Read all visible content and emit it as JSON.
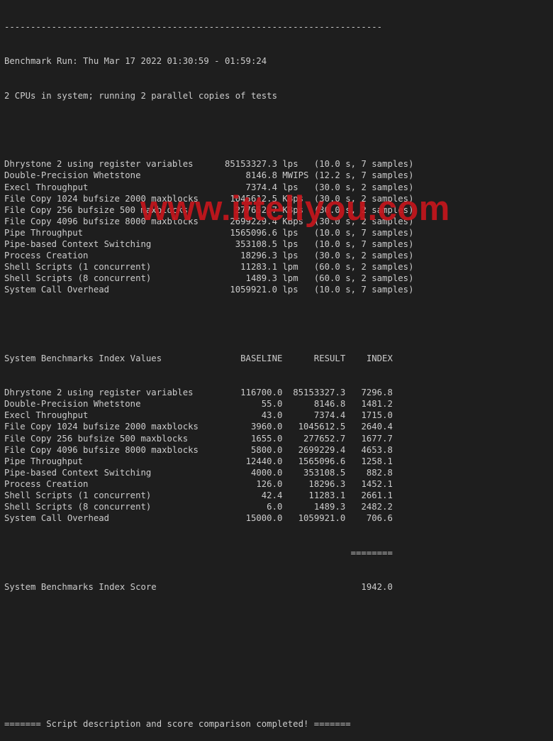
{
  "terminal": {
    "separator": "------------------------------------------------------------------------",
    "benchmark_run": "Benchmark Run: Thu Mar 17 2022 01:30:59 - 01:59:24",
    "cpu_info": "2 CPUs in system; running 2 parallel copies of tests",
    "results": [
      {
        "test": "Dhrystone 2 using register variables",
        "value": "85153327.3",
        "unit": "lps",
        "time": "10.0 s",
        "samples": "7 samples"
      },
      {
        "test": "Double-Precision Whetstone",
        "value": "8146.8",
        "unit": "MWIPS",
        "time": "12.2 s",
        "samples": "7 samples"
      },
      {
        "test": "Execl Throughput",
        "value": "7374.4",
        "unit": "lps",
        "time": "30.0 s",
        "samples": "2 samples"
      },
      {
        "test": "File Copy 1024 bufsize 2000 maxblocks",
        "value": "1045612.5",
        "unit": "KBps",
        "time": "30.0 s",
        "samples": "2 samples"
      },
      {
        "test": "File Copy 256 bufsize 500 maxblocks",
        "value": "277652.7",
        "unit": "KBps",
        "time": "30.0 s",
        "samples": "2 samples"
      },
      {
        "test": "File Copy 4096 bufsize 8000 maxblocks",
        "value": "2699229.4",
        "unit": "KBps",
        "time": "30.0 s",
        "samples": "2 samples"
      },
      {
        "test": "Pipe Throughput",
        "value": "1565096.6",
        "unit": "lps",
        "time": "10.0 s",
        "samples": "7 samples"
      },
      {
        "test": "Pipe-based Context Switching",
        "value": "353108.5",
        "unit": "lps",
        "time": "10.0 s",
        "samples": "7 samples"
      },
      {
        "test": "Process Creation",
        "value": "18296.3",
        "unit": "lps",
        "time": "30.0 s",
        "samples": "2 samples"
      },
      {
        "test": "Shell Scripts (1 concurrent)",
        "value": "11283.1",
        "unit": "lpm",
        "time": "60.0 s",
        "samples": "2 samples"
      },
      {
        "test": "Shell Scripts (8 concurrent)",
        "value": "1489.3",
        "unit": "lpm",
        "time": "60.0 s",
        "samples": "2 samples"
      },
      {
        "test": "System Call Overhead",
        "value": "1059921.0",
        "unit": "lps",
        "time": "10.0 s",
        "samples": "7 samples"
      }
    ],
    "index_header": {
      "title": "System Benchmarks Index Values",
      "baseline": "BASELINE",
      "result": "RESULT",
      "index": "INDEX"
    },
    "index_rows": [
      {
        "test": "Dhrystone 2 using register variables",
        "baseline": "116700.0",
        "result": "85153327.3",
        "index": "7296.8"
      },
      {
        "test": "Double-Precision Whetstone",
        "baseline": "55.0",
        "result": "8146.8",
        "index": "1481.2"
      },
      {
        "test": "Execl Throughput",
        "baseline": "43.0",
        "result": "7374.4",
        "index": "1715.0"
      },
      {
        "test": "File Copy 1024 bufsize 2000 maxblocks",
        "baseline": "3960.0",
        "result": "1045612.5",
        "index": "2640.4"
      },
      {
        "test": "File Copy 256 bufsize 500 maxblocks",
        "baseline": "1655.0",
        "result": "277652.7",
        "index": "1677.7"
      },
      {
        "test": "File Copy 4096 bufsize 8000 maxblocks",
        "baseline": "5800.0",
        "result": "2699229.4",
        "index": "4653.8"
      },
      {
        "test": "Pipe Throughput",
        "baseline": "12440.0",
        "result": "1565096.6",
        "index": "1258.1"
      },
      {
        "test": "Pipe-based Context Switching",
        "baseline": "4000.0",
        "result": "353108.5",
        "index": "882.8"
      },
      {
        "test": "Process Creation",
        "baseline": "126.0",
        "result": "18296.3",
        "index": "1452.1"
      },
      {
        "test": "Shell Scripts (1 concurrent)",
        "baseline": "42.4",
        "result": "11283.1",
        "index": "2661.1"
      },
      {
        "test": "Shell Scripts (8 concurrent)",
        "baseline": "6.0",
        "result": "1489.3",
        "index": "2482.2"
      },
      {
        "test": "System Call Overhead",
        "baseline": "15000.0",
        "result": "1059921.0",
        "index": "706.6"
      }
    ],
    "score_separator": "========",
    "score_label": "System Benchmarks Index Score",
    "score_value": "1942.0",
    "completion_message": "======= Script description and score comparison completed! ======="
  },
  "watermark": {
    "text": "www.ittellyou.com",
    "color": "#c4161c"
  }
}
